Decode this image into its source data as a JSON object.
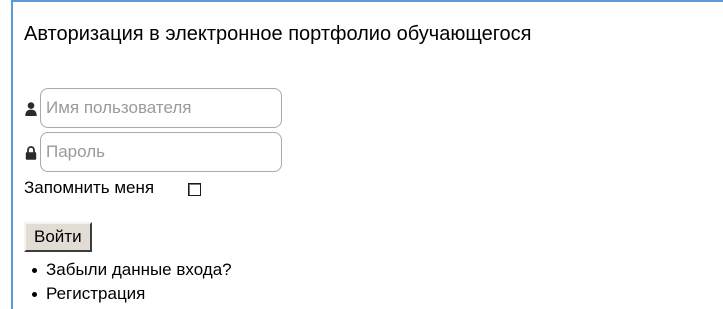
{
  "form": {
    "title": "Авторизация в электронное портфолио обучающегося",
    "username": {
      "icon": "user-icon",
      "value": "",
      "placeholder": "Имя пользователя"
    },
    "password": {
      "icon": "lock-icon",
      "value": "",
      "placeholder": "Пароль"
    },
    "remember": {
      "label": "Запомнить меня",
      "checked": false
    },
    "submit_label": "Войти",
    "links": [
      {
        "label": "Забыли данные входа?"
      },
      {
        "label": "Регистрация"
      }
    ]
  },
  "colors": {
    "panel_border": "#5b9bd5",
    "button_face": "#e1ddd5",
    "placeholder": "#9a9a9a"
  }
}
